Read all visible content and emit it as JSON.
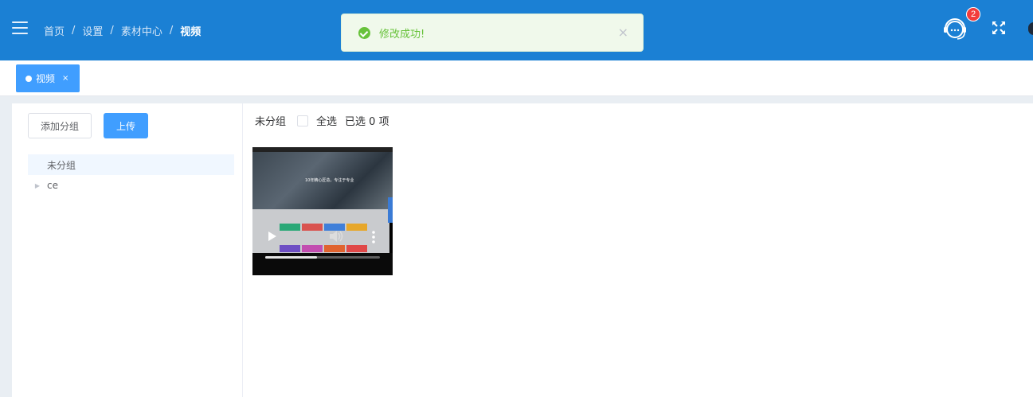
{
  "header": {
    "breadcrumb": [
      "首页",
      "设置",
      "素材中心",
      "视频"
    ],
    "separator": "/",
    "notification_count": "2",
    "menu_icon": "hamburger-icon",
    "support_icon": "headset-icon",
    "fullscreen_icon": "fullscreen-icon"
  },
  "toast": {
    "message": "修改成功!",
    "type": "success",
    "close_glyph": "×"
  },
  "tabs": [
    {
      "label": "视频",
      "active": true,
      "close": "×"
    }
  ],
  "sidebar": {
    "add_group_label": "添加分组",
    "upload_label": "上传",
    "groups": [
      {
        "label": "未分组",
        "active": true,
        "has_children": false
      },
      {
        "label": "ce",
        "active": false,
        "has_children": true
      }
    ]
  },
  "content": {
    "group_title": "未分组",
    "select_all_label": "全选",
    "selected_text": "已选 0 项",
    "videos": [
      {
        "thumb_caption": "10年精心匠造，专注于专业",
        "progress": 0.45
      }
    ]
  },
  "colors": {
    "header_bg": "#1b80d4",
    "primary": "#409eff",
    "success": "#67c23a",
    "badge": "#f23c3c"
  }
}
